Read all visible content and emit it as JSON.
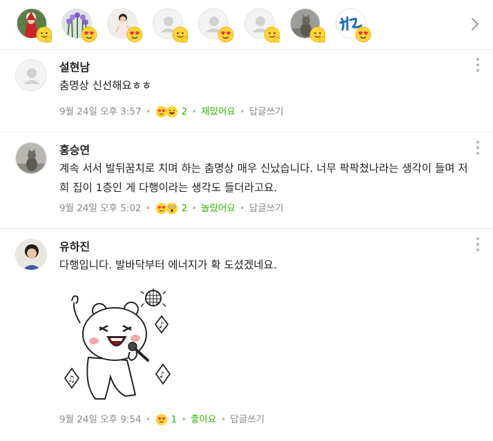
{
  "reactors": [
    {
      "avatar": "photo-santa",
      "emotion": "good-icon"
    },
    {
      "avatar": "photo-flowers",
      "emotion": "love-icon"
    },
    {
      "avatar": "photo-person",
      "emotion": "love-icon"
    },
    {
      "avatar": "default-profile",
      "emotion": "good-icon"
    },
    {
      "avatar": "default-profile",
      "emotion": "love-icon"
    },
    {
      "avatar": "default-profile",
      "emotion": "good-icon"
    },
    {
      "avatar": "photo-cat",
      "emotion": "good-icon"
    },
    {
      "avatar": "logo-calligraphy",
      "emotion": "love-icon"
    }
  ],
  "comments": [
    {
      "name": "설현남",
      "text": "춤명상 신선해요ㅎㅎ",
      "time": "9월 24일 오후 3:57",
      "reaction_count": "2",
      "reaction_label": "재밌어요",
      "reply_label": "답글쓰기",
      "avatar": "default-profile"
    },
    {
      "name": "홍승연",
      "text": "계속 서서 발뒤꿈치로 치며 하는 춤명상 매우 신났습니다. 너무 팍팍쳤나라는 생각이 들며 저희 집이 1층인 게 다행이라는 생각도 들더라고요.",
      "time": "9월 24일 오후 5:02",
      "reaction_count": "2",
      "reaction_label": "놀랐어요",
      "reply_label": "답글쓰기",
      "avatar": "photo-cat"
    },
    {
      "name": "유하진",
      "text": "다행입니다. 발바닥부터 에너지가 확 도셨겠네요.",
      "time": "9월 24일 오후 9:54",
      "reaction_count": "1",
      "reaction_label": "좋아요",
      "reply_label": "답글쓰기",
      "avatar": "photo-person",
      "sticker": "dancing-bear-microphone-sticker"
    }
  ],
  "colors": {
    "accent": "#2db400",
    "meta_text": "#888888",
    "divider": "#e8e8e8",
    "emoji_yellow": "#ffd43b",
    "heart_red": "#f0313e"
  }
}
